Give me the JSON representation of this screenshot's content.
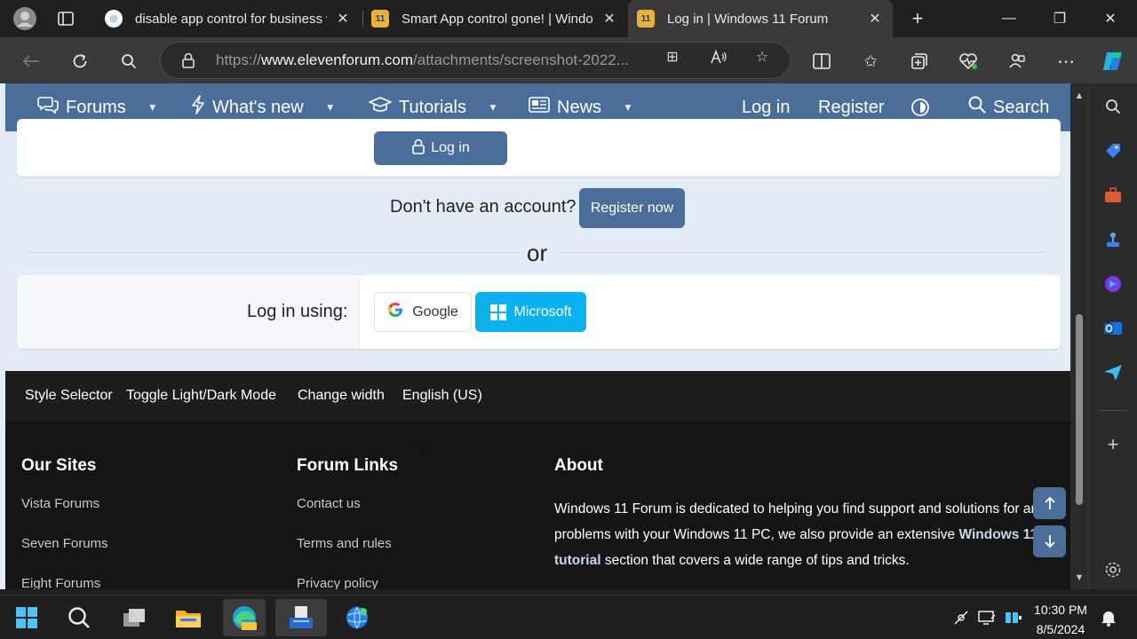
{
  "browser": {
    "tabs": [
      {
        "title": "disable app control for business w",
        "close": "✕"
      },
      {
        "title": "Smart App control gone! | Windo",
        "close": "✕"
      },
      {
        "title": "Log in | Windows 11 Forum",
        "close": "✕"
      }
    ],
    "url_prefix": "https://",
    "url_domain": "www.elevenforum.com",
    "url_path": "/attachments/screenshot-2022...",
    "new_tab": "+",
    "window_controls": [
      "—",
      "❐",
      "✕"
    ]
  },
  "forum_nav": {
    "items": [
      "Forums",
      "What's new",
      "Tutorials",
      "News"
    ],
    "login": "Log in",
    "register": "Register",
    "search": "Search"
  },
  "login": {
    "button": "Log in",
    "no_account": "Don't have an account?",
    "register_now": "Register now",
    "or": "or",
    "log_in_using": "Log in using:",
    "google": "Google",
    "microsoft": "Microsoft"
  },
  "footer": {
    "bar_links": [
      "Style Selector",
      "Toggle Light/Dark Mode",
      "Change width",
      "English (US)"
    ],
    "our_sites": {
      "heading": "Our Sites",
      "items": [
        "Vista Forums",
        "Seven Forums",
        "Eight Forums"
      ]
    },
    "forum_links": {
      "heading": "Forum Links",
      "items": [
        "Contact us",
        "Terms and rules",
        "Privacy policy"
      ]
    },
    "about": {
      "heading": "About",
      "text_1": "Windows 11 Forum is dedicated to helping you find support and solutions for any problems with your Windows 11 PC, we also provide an extensive",
      "text_bold": "Windows 11 tutorial",
      "text_2": "section that covers a wide range of tips and tricks."
    }
  },
  "taskbar": {
    "time": "10:30 PM",
    "date": "8/5/2024"
  },
  "colors": {
    "forum_blue": "#4a6d99",
    "microsoft_blue": "#0ab3ef",
    "page_bg": "#e4edf7",
    "footer_bg": "#151515"
  }
}
